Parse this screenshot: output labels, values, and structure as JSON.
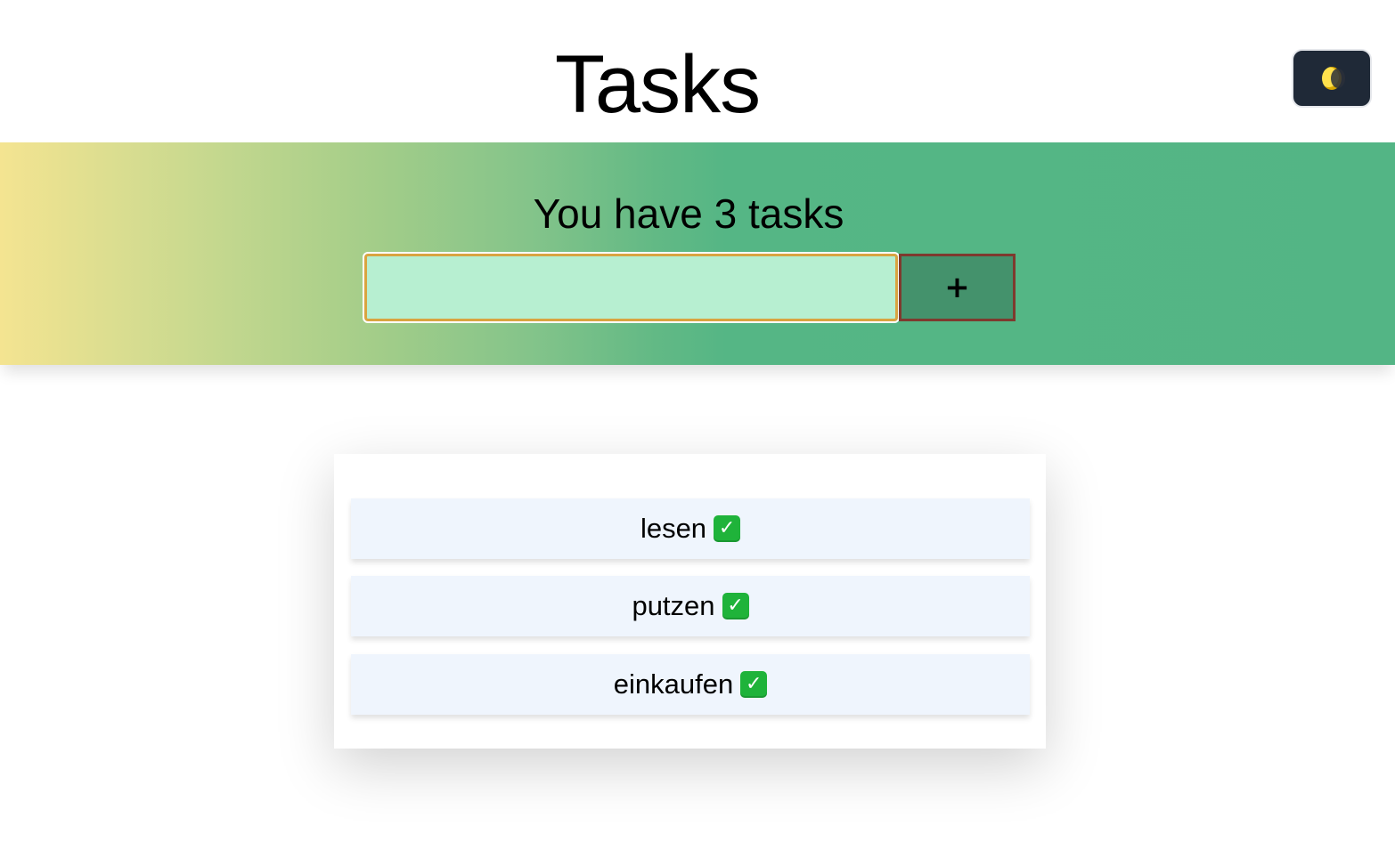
{
  "header": {
    "title": "Tasks",
    "theme_toggle_icon": "moon-icon"
  },
  "hero": {
    "count_text": "You have 3 tasks",
    "input_value": "",
    "input_placeholder": "",
    "add_button_label": "+",
    "gradient_colors": [
      "#f4e491",
      "#53b585"
    ]
  },
  "tasks": [
    {
      "label": "lesen",
      "status_icon": "check-mark-icon",
      "status_glyph": "✓"
    },
    {
      "label": "putzen",
      "status_icon": "check-mark-icon",
      "status_glyph": "✓"
    },
    {
      "label": "einkaufen",
      "status_icon": "check-mark-icon",
      "status_glyph": "✓"
    }
  ],
  "colors": {
    "input_background": "#b7efd1",
    "add_button_background": "#44926c",
    "task_item_background": "#eff5fd",
    "toggle_background": "#1f2937",
    "check_green": "#1fb33a"
  }
}
